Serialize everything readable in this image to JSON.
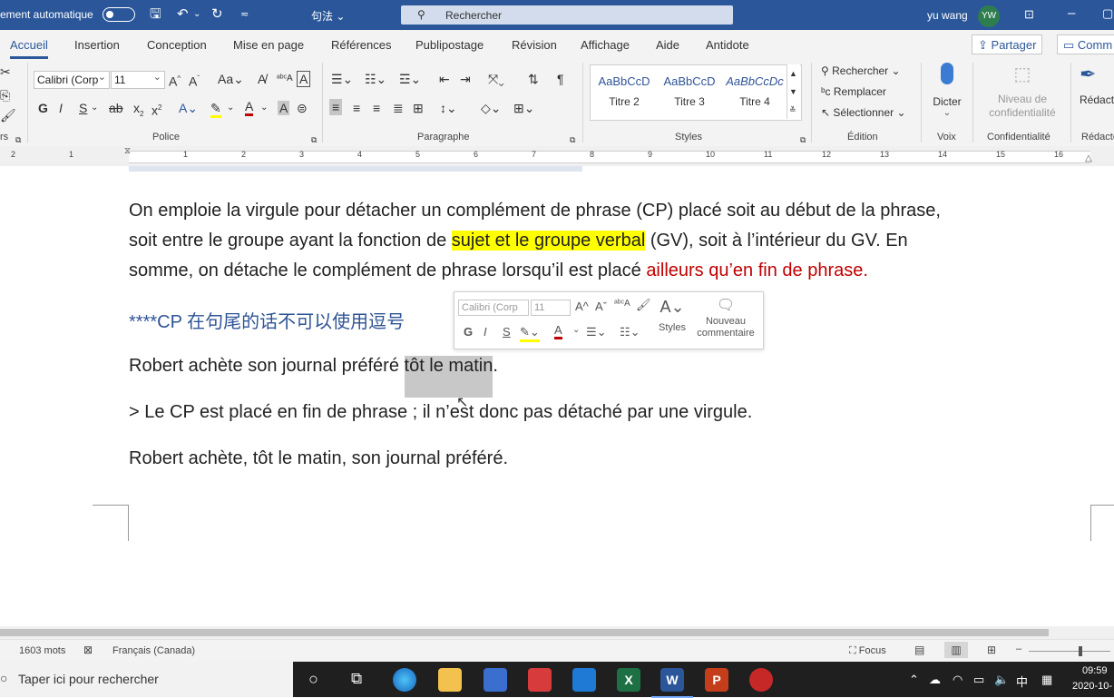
{
  "titlebar": {
    "autosave_label": "ement automatique",
    "document_title": "句法",
    "search_placeholder": "Rechercher",
    "user_name": "yu wang",
    "user_initials": "YW",
    "accent_color": "#2b579a"
  },
  "tabs": [
    "Accueil",
    "Insertion",
    "Conception",
    "Mise en page",
    "Références",
    "Publipostage",
    "Révision",
    "Affichage",
    "Aide",
    "Antidote"
  ],
  "share_label": "Partager",
  "comments_label": "Comm",
  "ribbon": {
    "clipboard_label": "rs",
    "font": {
      "name": "Calibri (Corp",
      "size": "11",
      "group_label": "Police"
    },
    "paragraph": {
      "group_label": "Paragraphe"
    },
    "styles": {
      "items": [
        {
          "sample": "AaBbCcD",
          "name": "Titre 2"
        },
        {
          "sample": "AaBbCcD",
          "name": "Titre 3"
        },
        {
          "sample": "AaBbCcDc",
          "name": "Titre 4"
        }
      ],
      "group_label": "Styles"
    },
    "editing": {
      "find": "Rechercher",
      "replace": "Remplacer",
      "select": "Sélectionner",
      "group_label": "Édition"
    },
    "voice": {
      "dictate": "Dicter",
      "group_label": "Voix"
    },
    "sensitivity": {
      "button": "Niveau de confidentialité",
      "group_label": "Confidentialité"
    },
    "editor": {
      "button": "Rédacte",
      "group_label": "Rédacte"
    }
  },
  "ruler": {
    "numbers": [
      "2",
      "1",
      "1",
      "2",
      "3",
      "4",
      "5",
      "6",
      "7",
      "8",
      "9",
      "10",
      "11",
      "12",
      "13",
      "14",
      "15",
      "16"
    ]
  },
  "document": {
    "para1_line1": " On emploie la virgule pour détacher un complément de phrase (CP) placé soit au début de la phrase,",
    "para1_line2_a": "soit entre le groupe ayant la fonction de ",
    "para1_line2_hl": "sujet et le groupe verbal",
    "para1_line2_b": " (GV), soit à l’intérieur du GV. En",
    "para1_line3_a": "somme, on détache le complément de phrase lorsqu’il est placé ",
    "para1_line3_red": "ailleurs qu’en fin de phrase.",
    "note": "****CP 在句尾的话不可以使用逗号",
    "ex1_a": "Robert achète son journal préféré ",
    "ex1_sel": "tôt le matin",
    "ex1_b": ".",
    "ex2": "> Le CP est placé en fin de phrase ; il n’est donc pas détaché par une virgule.",
    "ex3": "Robert achète, tôt le matin, son journal préféré."
  },
  "mini_toolbar": {
    "font": "Calibri (Corp",
    "size": "11",
    "styles": "Styles",
    "new_comment": "Nouveau commentaire"
  },
  "status": {
    "words": "1603 mots",
    "language": "Français (Canada)",
    "focus": "Focus"
  },
  "taskbar": {
    "search_placeholder": "Taper ici pour rechercher",
    "time": "09:59",
    "date": "2020-10-",
    "ime": "中"
  }
}
